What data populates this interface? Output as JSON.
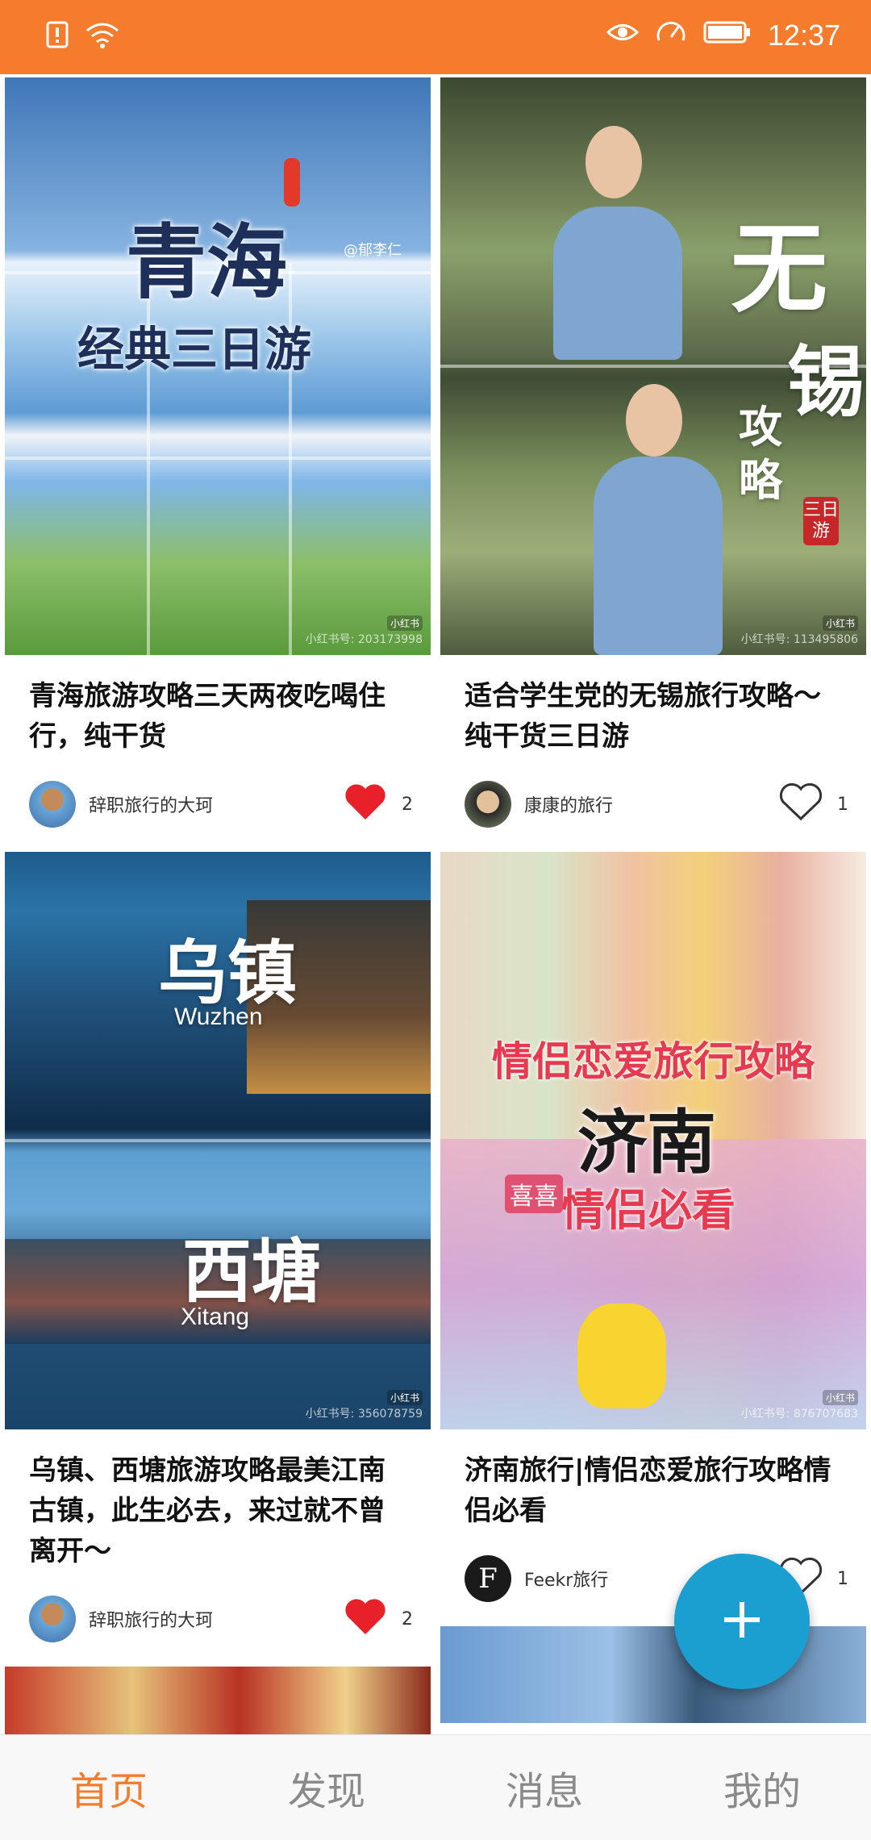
{
  "status_bar": {
    "time": "12:37",
    "icons": [
      "alert-icon",
      "wifi-icon",
      "eye-icon",
      "speed-icon",
      "battery-icon"
    ]
  },
  "feed": {
    "left": [
      {
        "cover": {
          "headline": "青海",
          "sub": "经典三日游",
          "watermark": "小红书号: 203173998",
          "tag": "小红书",
          "credit": "@郁李仁"
        },
        "title": "青海旅游攻略三天两夜吃喝住行，纯干货",
        "author": "辞职旅行的大珂",
        "likes": "2",
        "liked": true
      },
      {
        "cover": {
          "headline": "乌镇",
          "headline_en": "Wuzhen",
          "headline2": "西塘",
          "headline2_en": "Xitang",
          "watermark": "小红书号: 356078759",
          "tag": "小红书"
        },
        "title": "乌镇、西塘旅游攻略最美江南古镇，此生必去，来过就不曾离开～",
        "author": "辞职旅行的大珂",
        "likes": "2",
        "liked": true
      }
    ],
    "right": [
      {
        "cover": {
          "headline": "无",
          "headline_b": "锡",
          "side": "攻略",
          "stamp": "三日游",
          "watermark": "小红书号: 113495806",
          "tag": "小红书"
        },
        "title": "适合学生党的无锡旅行攻略～纯干货三日游",
        "author": "康康的旅行",
        "likes": "1",
        "liked": false
      },
      {
        "cover": {
          "headline": "情侣恋爱旅行攻略",
          "headline2": "济南",
          "sub": "情侣必看",
          "sign": "喜喜",
          "watermark": "小红书号: 876707683",
          "tag": "小红书"
        },
        "title": "济南旅行|情侣恋爱旅行攻略情侣必看",
        "author": "Feekr旅行",
        "author_initial": "F",
        "likes": "1",
        "liked": false
      }
    ]
  },
  "fab": {
    "icon": "plus-icon"
  },
  "nav": [
    {
      "label": "首页",
      "active": true
    },
    {
      "label": "发现",
      "active": false
    },
    {
      "label": "消息",
      "active": false
    },
    {
      "label": "我的",
      "active": false
    }
  ],
  "colors": {
    "accent": "#f47c2c",
    "fab": "#1a9fd0",
    "like_red": "#e8202a"
  }
}
